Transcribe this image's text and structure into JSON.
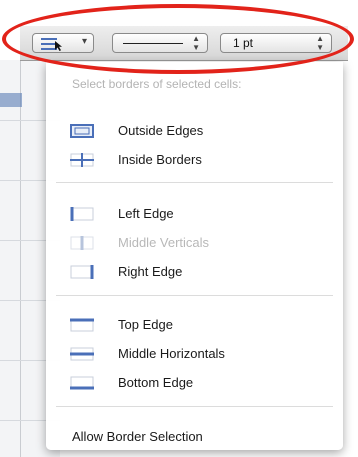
{
  "toolbar": {
    "border_tool_icon": "border-select-icon",
    "line_style": "solid",
    "stroke_width": "1 pt"
  },
  "menu": {
    "header": "Select borders of selected cells:",
    "items": [
      {
        "label": "Outside Edges",
        "icon": "outside-edges-icon",
        "enabled": true
      },
      {
        "label": "Inside Borders",
        "icon": "inside-borders-icon",
        "enabled": true
      },
      {
        "label": "Left Edge",
        "icon": "left-edge-icon",
        "enabled": true
      },
      {
        "label": "Middle Verticals",
        "icon": "middle-verticals-icon",
        "enabled": false
      },
      {
        "label": "Right Edge",
        "icon": "right-edge-icon",
        "enabled": true
      },
      {
        "label": "Top Edge",
        "icon": "top-edge-icon",
        "enabled": true
      },
      {
        "label": "Middle Horizontals",
        "icon": "middle-horizontals-icon",
        "enabled": true
      },
      {
        "label": "Bottom Edge",
        "icon": "bottom-edge-icon",
        "enabled": true
      }
    ],
    "allow_selection": "Allow Border Selection"
  },
  "colors": {
    "annotation": "#e2231a",
    "icon_blue": "#4a6fb8"
  }
}
